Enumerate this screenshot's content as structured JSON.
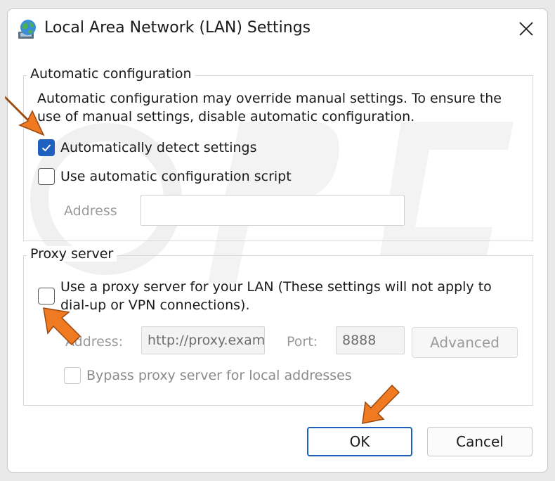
{
  "window": {
    "title": "Local Area Network (LAN) Settings",
    "icon": "network-globe-icon"
  },
  "automatic_config": {
    "legend": "Automatic configuration",
    "description_line1": "Automatic configuration may override manual settings.  To ensure the",
    "description_line2": "use of manual settings, disable automatic configuration.",
    "detect_label": "Automatically detect settings",
    "detect_checked": true,
    "script_label": "Use automatic configuration script",
    "script_checked": false,
    "address_label": "Address",
    "address_value": ""
  },
  "proxy": {
    "legend": "Proxy server",
    "use_proxy_line1": "Use a proxy server for your LAN (These settings will not apply to",
    "use_proxy_line2": "dial-up or VPN connections).",
    "use_proxy_checked": false,
    "address_label": "Address:",
    "address_value": "http://proxy.exam",
    "port_label": "Port:",
    "port_value": "8888",
    "advanced_label": "Advanced",
    "bypass_label": "Bypass proxy server for local addresses",
    "bypass_checked": false
  },
  "buttons": {
    "ok": "OK",
    "cancel": "Cancel"
  },
  "colors": {
    "accent": "#1f5fbf",
    "annotation_arrow": "#f07a22"
  }
}
